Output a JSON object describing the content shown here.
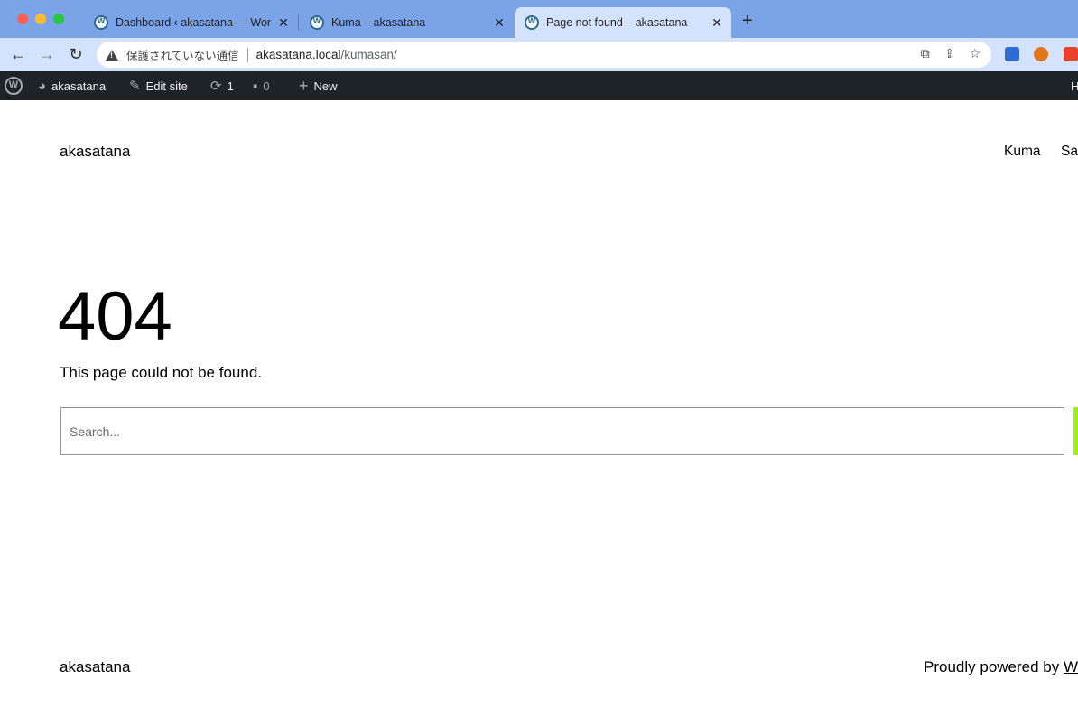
{
  "browser": {
    "tabs": [
      {
        "title": "Dashboard ‹ akasatana — WordPress"
      },
      {
        "title": "Kuma – akasatana"
      },
      {
        "title": "Page not found – akasatana"
      }
    ],
    "close_glyph": "✕",
    "new_tab_glyph": "+",
    "security_label": "保護されていない通信",
    "url_host": "akasatana.local",
    "url_path": "/kumasan/"
  },
  "adminbar": {
    "site_name": "akasatana",
    "edit_site": "Edit site",
    "updates_count": "1",
    "comments_count": "0",
    "new_label": "New",
    "howdy_partial": "H"
  },
  "site": {
    "title": "akasatana",
    "nav": [
      "Kuma",
      "Sa"
    ]
  },
  "main": {
    "error_code": "404",
    "message": "This page could not be found.",
    "search_placeholder": "Search..."
  },
  "footer": {
    "title": "akasatana",
    "powered_prefix": "Proudly powered by ",
    "powered_link": "W"
  },
  "colors": {
    "tabstrip": "#7ba3e8",
    "toolbar": "#d3e3fd",
    "adminbar": "#1d2327",
    "search_button_accent": "#9ef01a"
  }
}
